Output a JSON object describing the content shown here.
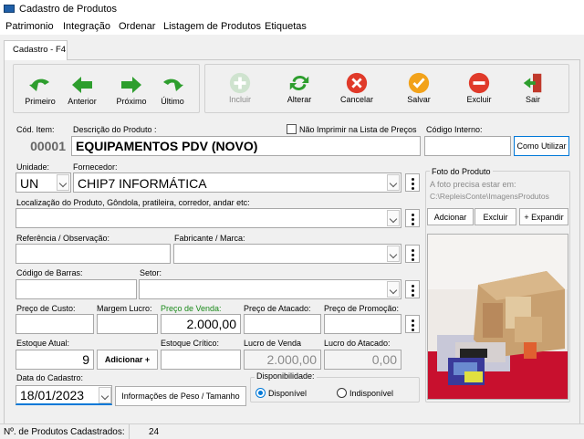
{
  "window": {
    "title": "Cadastro de Produtos"
  },
  "menu": [
    "Patrimonio",
    "Integração",
    "Ordenar",
    "Listagem de Produtos",
    "Etiquetas"
  ],
  "tab": "Cadastro - F4",
  "toolbar": {
    "nav": [
      "Primeiro",
      "Anterior",
      "Próximo",
      "Último"
    ],
    "actions": [
      "Incluir",
      "Alterar",
      "Cancelar",
      "Salvar",
      "Excluir",
      "Sair"
    ]
  },
  "form": {
    "cod_item_label": "Cód. Item:",
    "cod_item_value": "00001",
    "descricao_label": "Descrição do Produto :",
    "descricao_value": "EQUIPAMENTOS PDV (NOVO)",
    "nao_imprimir_label": "Não Imprimir  na Lista de Preços",
    "codigo_interno_label": "Código Interno:",
    "codigo_interno_value": "",
    "como_utilizar_label": "Como Utilizar",
    "unidade_label": "Unidade:",
    "unidade_value": "UN",
    "fornecedor_label": "Fornecedor:",
    "fornecedor_value": "CHIP7 INFORMÁTICA",
    "localizacao_label": "Localização do Produto, Gôndola, pratileira, corredor, andar etc:",
    "localizacao_value": "",
    "referencia_label": "Referência / Observação:",
    "fabricante_label": "Fabricante / Marca:",
    "codigo_barras_label": "Código de Barras:",
    "setor_label": "Setor:",
    "preco_custo_label": "Preço de Custo:",
    "margem_lucro_label": "Margem Lucro:",
    "preco_venda_label": "Preço de Venda:",
    "preco_venda_value": "2.000,00",
    "preco_atacado_label": "Preço de Atacado:",
    "preco_promocao_label": "Preço de Promoção:",
    "estoque_atual_label": "Estoque Atual:",
    "estoque_atual_value": "9",
    "adicionar_label": "Adicionar +",
    "estoque_critico_label": "Estoque Crítico:",
    "lucro_venda_label": "Lucro de Venda",
    "lucro_venda_value": "2.000,00",
    "lucro_atacado_label": "Lucro do Atacado:",
    "lucro_atacado_value": "0,00",
    "data_cadastro_label": "Data do Cadastro:",
    "data_cadastro_value": "18/01/2023",
    "info_peso_label": "Informações de Peso / Tamanho",
    "disponibilidade_label": "Disponibilidade:",
    "disponivel_label": "Disponível",
    "indisponivel_label": "Indisponível"
  },
  "photo": {
    "title": "Foto do Produto",
    "hint1": "A foto precisa estar em:",
    "hint2": "C:\\RepleisConte\\ImagensProdutos",
    "btn_adicionar": "Adcionar",
    "btn_excluir": "Excluir",
    "btn_expandir": "+ Expandir"
  },
  "status": {
    "label": "Nº. de Produtos Cadastrados:",
    "count": "24"
  },
  "colors": {
    "accent": "#0078d7",
    "price_green": "#1a8a1a",
    "nav_green": "#2e9e2e"
  }
}
